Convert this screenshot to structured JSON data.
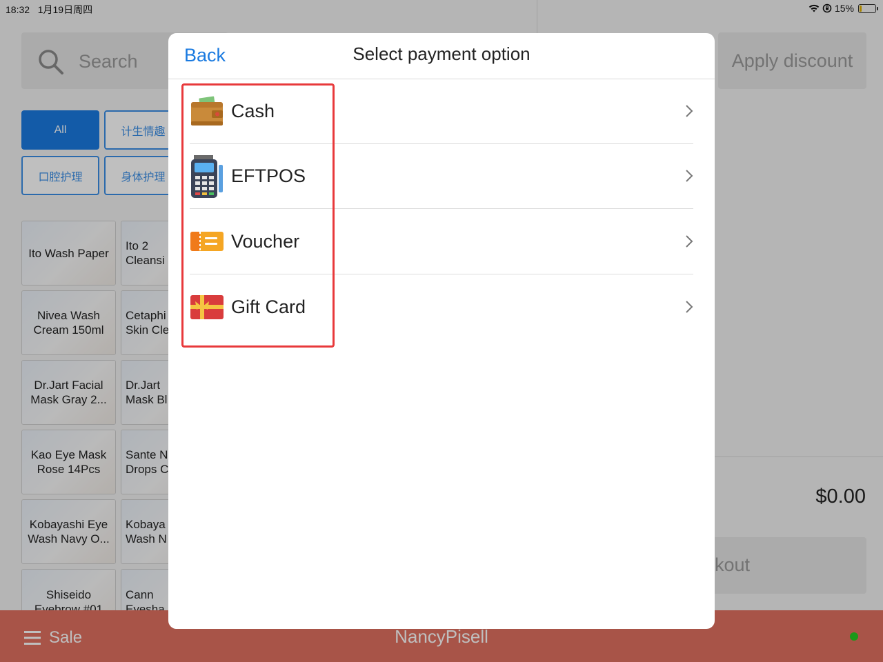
{
  "status_bar": {
    "time": "18:32",
    "date": "1月19日周四",
    "battery": "15%",
    "battery_level": 0.15
  },
  "search": {
    "placeholder": "Search"
  },
  "categories": [
    {
      "label": "All",
      "active": true
    },
    {
      "label": "计生情趣",
      "active": false
    },
    {
      "label": "口腔护理",
      "active": false
    },
    {
      "label": "身体护理",
      "active": false
    }
  ],
  "products": [
    {
      "name": "Ito Wash Paper"
    },
    {
      "name": "Ito 2\nCleansi"
    },
    {
      "name": "Nivea Wash\nCream 150ml"
    },
    {
      "name": "Cetaphi\nSkin Cle"
    },
    {
      "name": "Dr.Jart Facial\nMask Gray 2..."
    },
    {
      "name": "Dr.Jart\nMask Bl"
    },
    {
      "name": "Kao Eye Mask\nRose 14Pcs"
    },
    {
      "name": "Sante N\nDrops C"
    },
    {
      "name": "Kobayashi Eye\nWash Navy O..."
    },
    {
      "name": "Kobaya\nWash N"
    },
    {
      "name": "Shiseido\nEyebrow #01"
    },
    {
      "name": "Cann\nEyesha"
    }
  ],
  "cart": {
    "apply_discount": "Apply discount",
    "total": "$0.00",
    "checkout": "kout"
  },
  "bottom_bar": {
    "menu_label": "Sale",
    "user": "NancyPisell",
    "online_color": "#22cc22"
  },
  "modal": {
    "back_label": "Back",
    "title": "Select payment option",
    "options": [
      {
        "label": "Cash",
        "icon": "wallet-icon"
      },
      {
        "label": "EFTPOS",
        "icon": "card-terminal-icon"
      },
      {
        "label": "Voucher",
        "icon": "ticket-icon"
      },
      {
        "label": "Gift Card",
        "icon": "gift-card-icon"
      }
    ]
  },
  "colors": {
    "accent": "#1a7ae0",
    "highlight": "#e8393b",
    "bottom_bar": "#e07060"
  }
}
